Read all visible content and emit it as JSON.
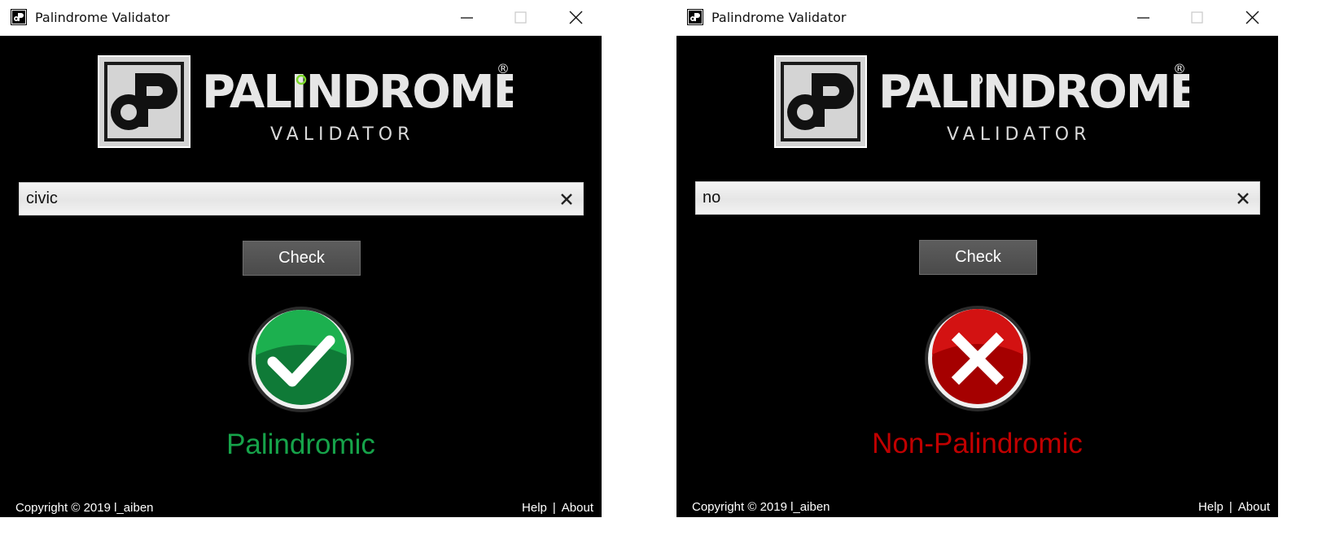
{
  "windows": [
    {
      "title": "Palindrome Validator",
      "input_value": "civic",
      "check_label": "Check",
      "result_label": "Palindromic",
      "result_state": "palindromic",
      "result_color": "#16a34a",
      "copyright": "Copyright © 2019  l_aiben",
      "help_label": "Help",
      "separator": "|",
      "about_label": "About"
    },
    {
      "title": "Palindrome Validator",
      "input_value": "no",
      "check_label": "Check",
      "result_label": "Non-Palindromic",
      "result_state": "non-palindromic",
      "result_color": "#c00000",
      "copyright": "Copyright © 2019  l_aiben",
      "help_label": "Help",
      "separator": "|",
      "about_label": "About"
    }
  ],
  "logo": {
    "wordmark": "PALINDROME",
    "subtitle": "VALIDATOR",
    "registered": "®",
    "badge": "dP"
  },
  "icons": {
    "app": "app-logo-icon",
    "minimize": "minimize-icon",
    "maximize": "maximize-icon",
    "close": "close-icon",
    "clear": "clear-x-icon",
    "success": "checkmark-circle-icon",
    "failure": "cross-circle-icon"
  },
  "colors": {
    "background": "#000000",
    "success": "#16a34a",
    "failure": "#c00000",
    "button": "#555555"
  }
}
